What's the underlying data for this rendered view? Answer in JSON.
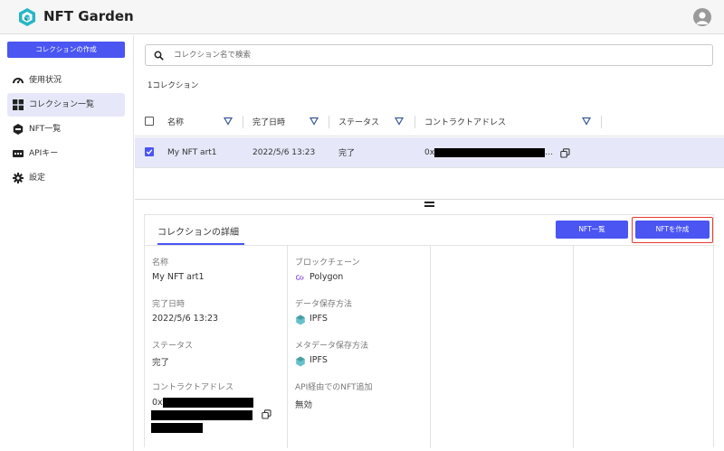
{
  "app": {
    "title": "NFT Garden"
  },
  "sidebar": {
    "create_button": "コレクションの作成",
    "items": [
      {
        "label": "使用状況",
        "icon": "speedometer-icon"
      },
      {
        "label": "コレクション一覧",
        "icon": "grid-icon"
      },
      {
        "label": "NFT一覧",
        "icon": "nft-hexagon-icon"
      },
      {
        "label": "APIキー",
        "icon": "api-icon"
      },
      {
        "label": "設定",
        "icon": "gear-icon"
      }
    ]
  },
  "search": {
    "placeholder": "コレクション名で検索",
    "value": ""
  },
  "collection_count": "1コレクション",
  "table": {
    "columns": [
      "名称",
      "完了日時",
      "ステータス",
      "コントラクトアドレス"
    ],
    "rows": [
      {
        "name": "My NFT art1",
        "completed_at": "2022/5/6 13:23",
        "status": "完了",
        "address_prefix": "0x",
        "address_suffix": "…",
        "selected": true
      }
    ]
  },
  "detail": {
    "tab": "コレクションの詳細",
    "nft_list_button": "NFT一覧",
    "create_nft_button": "NFTを作成",
    "fields": {
      "name_label": "名称",
      "name_value": "My NFT art1",
      "completed_label": "完了日時",
      "completed_value": "2022/5/6 13:23",
      "status_label": "ステータス",
      "status_value": "完了",
      "address_label": "コントラクトアドレス",
      "address_prefix": "0x",
      "blockchain_label": "ブロックチェーン",
      "blockchain_value": "Polygon",
      "data_storage_label": "データ保存方法",
      "data_storage_value": "IPFS",
      "metadata_storage_label": "メタデータ保存方法",
      "metadata_storage_value": "IPFS",
      "api_nft_label": "API経由でのNFT追加",
      "api_nft_value": "無効"
    }
  },
  "colors": {
    "accent": "#4a55f2",
    "selected_row": "#e6e8f9",
    "highlight": "#e53a2f",
    "polygon": "#8247e5",
    "ipfs": "#65c2cb"
  }
}
